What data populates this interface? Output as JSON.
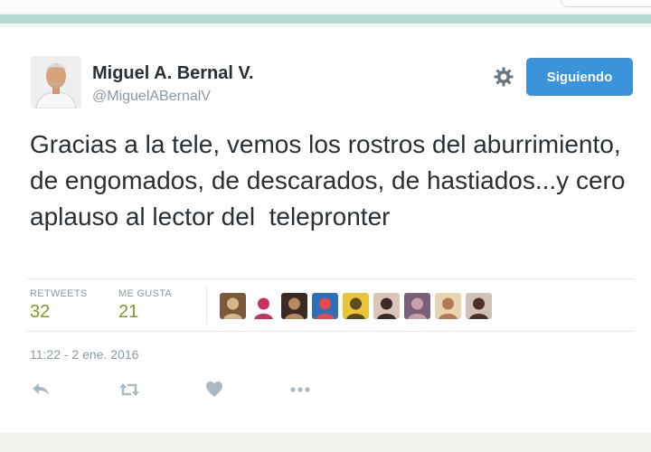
{
  "tweet": {
    "author_name": "Miguel A. Bernal V.",
    "handle": "@MiguelABernalV",
    "follow_label": "Siguiendo",
    "text": "Gracias a la tele, vemos los rostros del aburrimiento, de engomados, de descarados, de hastiados...y cero aplauso al lector del  telepronter",
    "retweets_label": "RETWEETS",
    "retweets_count": "32",
    "likes_label": "ME GUSTA",
    "likes_count": "21",
    "timestamp": "11:22 - 2 ene. 2016"
  },
  "icons": {
    "settings": "gear-icon",
    "reply": "reply-icon",
    "retweet": "retweet-icon",
    "like": "heart-icon",
    "more": "more-icon"
  },
  "colors": {
    "accent": "#3b94d9",
    "stat_value": "#8a9526",
    "text": "#292f33",
    "muted": "#8899a6",
    "icon": "#aab8c2"
  },
  "liked_by_avatars": [
    {
      "bg": "#7a5a3a",
      "fg": "#d8b48a"
    },
    {
      "bg": "#ffffff",
      "fg": "#c8325a"
    },
    {
      "bg": "#3b2b22",
      "fg": "#b98a5e"
    },
    {
      "bg": "#2d6fb8",
      "fg": "#e14b4b"
    },
    {
      "bg": "#e8c43a",
      "fg": "#5a4a20"
    },
    {
      "bg": "#d9c6b8",
      "fg": "#3a2a28"
    },
    {
      "bg": "#7a5f78",
      "fg": "#c7a0a8"
    },
    {
      "bg": "#e6d5b0",
      "fg": "#b57a50"
    },
    {
      "bg": "#cfc0b8",
      "fg": "#4a3028"
    }
  ]
}
